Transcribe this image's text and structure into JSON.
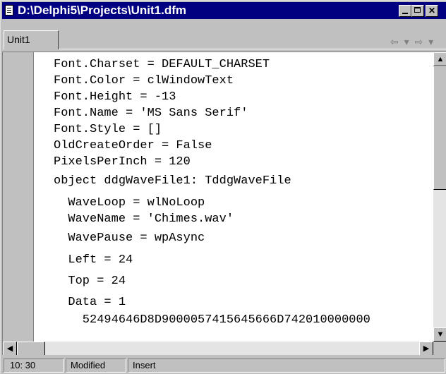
{
  "window": {
    "title": "D:\\Delphi5\\Projects\\Unit1.dfm",
    "icon": "document-icon"
  },
  "tabs": {
    "active": "Unit1"
  },
  "nav": {
    "back": "⇦ ▾",
    "forward": "⇨ ▾"
  },
  "code": {
    "lines": [
      "Font.Charset = DEFAULT_CHARSET",
      "Font.Color = clWindowText",
      "Font.Height = -13",
      "Font.Name = 'MS Sans Serif'",
      "Font.Style = []",
      "OldCreateOrder = False",
      "PixelsPerInch = 120",
      "object ddgWaveFile1: TddgWaveFile",
      "  WaveLoop = wlNoLoop",
      "  WaveName = 'Chimes.wav'",
      "  WavePause = wpAsync",
      "  Left = 24",
      "  Top = 24",
      "  Data = 1",
      "    52494646D8D9000057415645666D742010000000"
    ]
  },
  "status": {
    "position": "10: 30",
    "modified": "Modified",
    "mode": "Insert"
  }
}
